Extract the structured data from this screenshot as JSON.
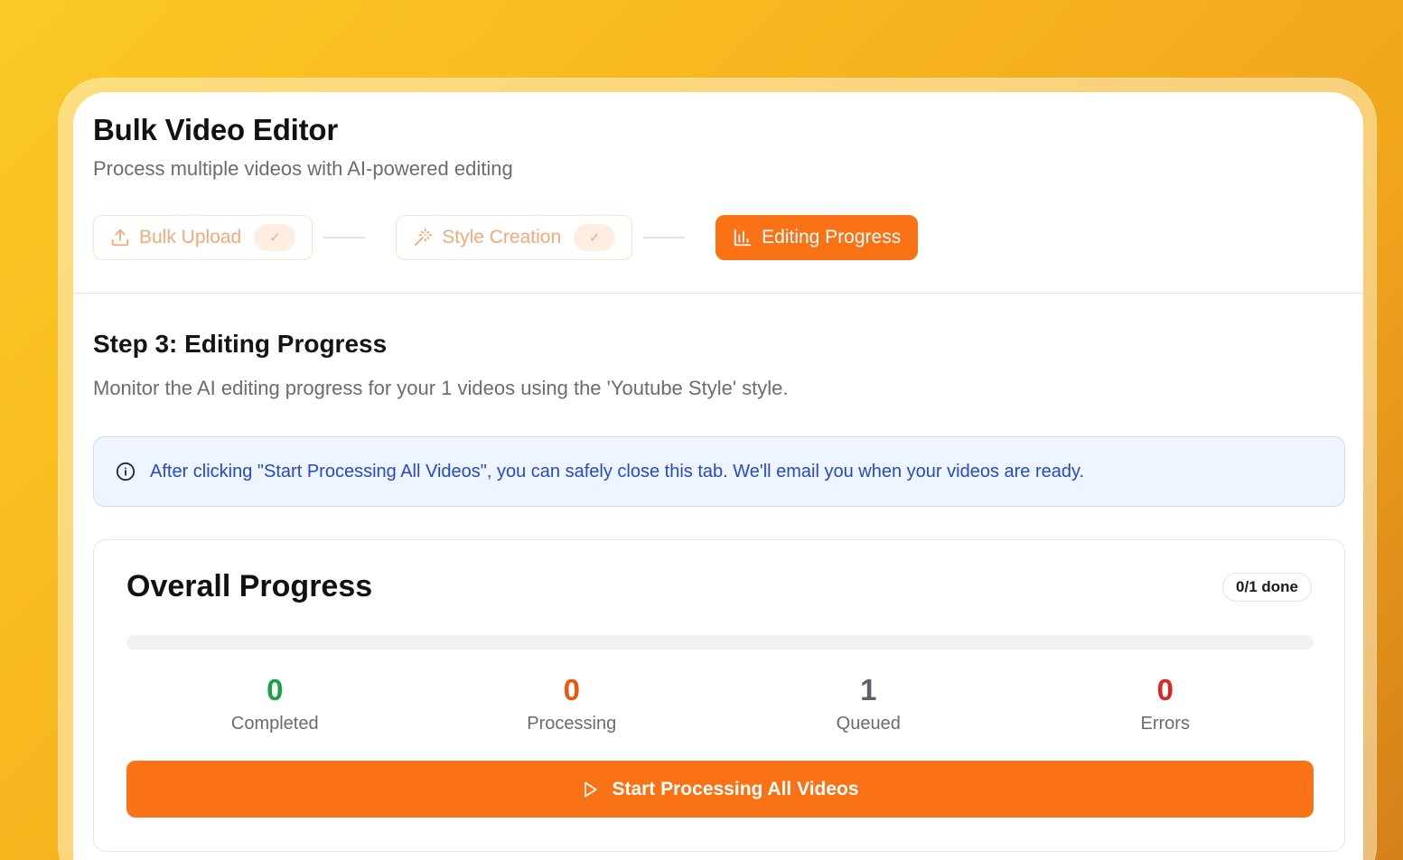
{
  "app": {
    "title": "Bulk Video Editor",
    "subtitle": "Process multiple videos with AI-powered editing"
  },
  "steps": [
    {
      "label": "Bulk Upload",
      "status": "completed",
      "icon": "upload-icon",
      "check": "✓"
    },
    {
      "label": "Style Creation",
      "status": "completed",
      "icon": "magic-wand-icon",
      "check": "✓"
    },
    {
      "label": "Editing Progress",
      "status": "active",
      "icon": "bar-chart-icon"
    }
  ],
  "current_step": {
    "title": "Step 3: Editing Progress",
    "description": "Monitor the AI editing progress for your 1 videos using the 'Youtube Style' style."
  },
  "notice": {
    "icon": "info-icon",
    "text": "After clicking \"Start Processing All Videos\", you can safely close this tab. We'll email you when your videos are ready."
  },
  "progress": {
    "title": "Overall Progress",
    "badge": "0/1 done",
    "fraction": 0,
    "stats": [
      {
        "value": "0",
        "label": "Completed",
        "color": "#16a34a"
      },
      {
        "value": "0",
        "label": "Processing",
        "color": "#ea580c"
      },
      {
        "value": "1",
        "label": "Queued",
        "color": "#5f6168"
      },
      {
        "value": "0",
        "label": "Errors",
        "color": "#dc2626"
      }
    ],
    "start_button": {
      "label": "Start Processing All Videos",
      "icon": "play-icon"
    }
  },
  "colors": {
    "accent": "#f97316",
    "background": "#fbc926"
  }
}
